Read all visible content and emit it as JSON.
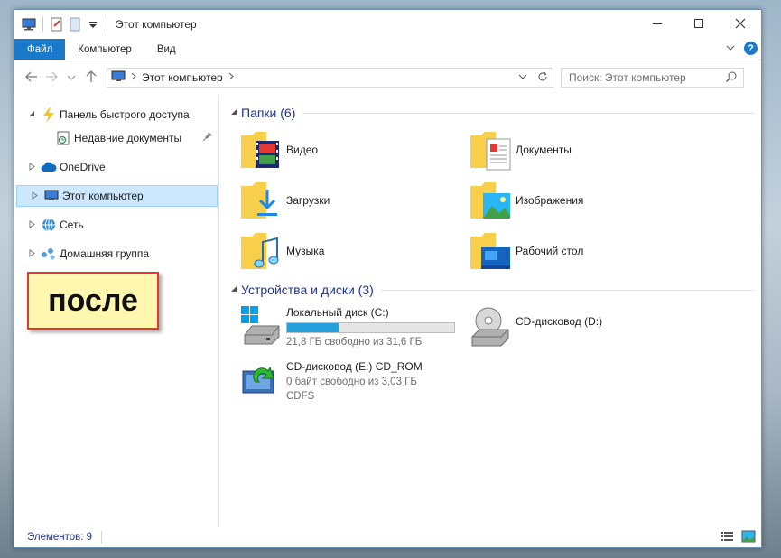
{
  "window": {
    "title": "Этот компьютер"
  },
  "ribbon": {
    "tabs": [
      "Файл",
      "Компьютер",
      "Вид"
    ],
    "help": "?"
  },
  "address": {
    "location": "Этот компьютер",
    "search_placeholder": "Поиск: Этот компьютер"
  },
  "nav": {
    "items": [
      {
        "label": "Панель быстрого доступа"
      },
      {
        "label": "Недавние документы"
      },
      {
        "label": "OneDrive"
      },
      {
        "label": "Этот компьютер"
      },
      {
        "label": "Сеть"
      },
      {
        "label": "Домашняя группа"
      }
    ]
  },
  "overlay": {
    "label": "после"
  },
  "folders_group": {
    "header": "Папки (6)",
    "items": [
      {
        "label": "Видео",
        "icon": "video-folder-icon"
      },
      {
        "label": "Документы",
        "icon": "documents-folder-icon"
      },
      {
        "label": "Загрузки",
        "icon": "downloads-folder-icon"
      },
      {
        "label": "Изображения",
        "icon": "pictures-folder-icon"
      },
      {
        "label": "Музыка",
        "icon": "music-folder-icon"
      },
      {
        "label": "Рабочий стол",
        "icon": "desktop-folder-icon"
      }
    ]
  },
  "devices_group": {
    "header": "Устройства и диски (3)",
    "items": [
      {
        "name": "Локальный диск (C:)",
        "free": "21,8 ГБ свободно из 31,6 ГБ",
        "used_fraction": 0.31
      },
      {
        "name": "CD-дисковод (D:)"
      },
      {
        "name": "CD-дисковод (E:) CD_ROM",
        "free": "0 байт свободно из 3,03 ГБ",
        "fs": "CDFS"
      }
    ]
  },
  "status": {
    "count": "Элементов: 9"
  },
  "colors": {
    "accent": "#1979ca",
    "selection": "#cce8ff",
    "group_header": "#1e3287",
    "folder": "#f8cf4a",
    "disk_bar": "#26a0da"
  }
}
